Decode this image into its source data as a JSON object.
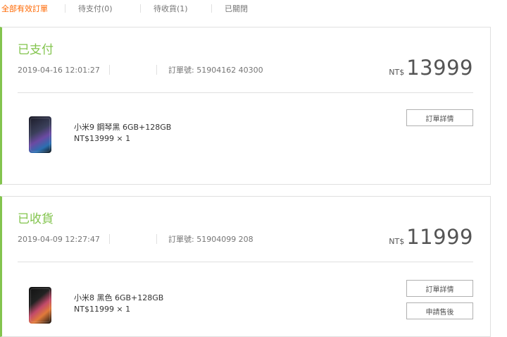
{
  "tabs": [
    {
      "label": "全部有效訂單",
      "active": true
    },
    {
      "label": "待支付(0)",
      "active": false
    },
    {
      "label": "待收貨(1)",
      "active": false
    },
    {
      "label": "已關閉",
      "active": false
    }
  ],
  "orders": [
    {
      "status": "已支付",
      "date": "2019-04-16 12:01:27",
      "order_no": "訂單號: 51904162     40300",
      "currency": "NT$",
      "amount": "13999",
      "item_name": "小米9 鋼琴黑 6GB+128GB",
      "item_price": "NT$13999 × 1",
      "detail_button": "訂單詳情"
    },
    {
      "status": "已收貨",
      "date": "2019-04-09 12:27:47",
      "order_no": "訂單號: 51904099     208",
      "currency": "NT$",
      "amount": "11999",
      "item_name": "小米8 黑色 6GB+128GB",
      "item_price": "NT$11999 × 1",
      "detail_button": "訂單詳情",
      "after_sale_button": "申請售後"
    }
  ],
  "colors": {
    "accent": "#ff6700",
    "status": "#83c44e"
  }
}
